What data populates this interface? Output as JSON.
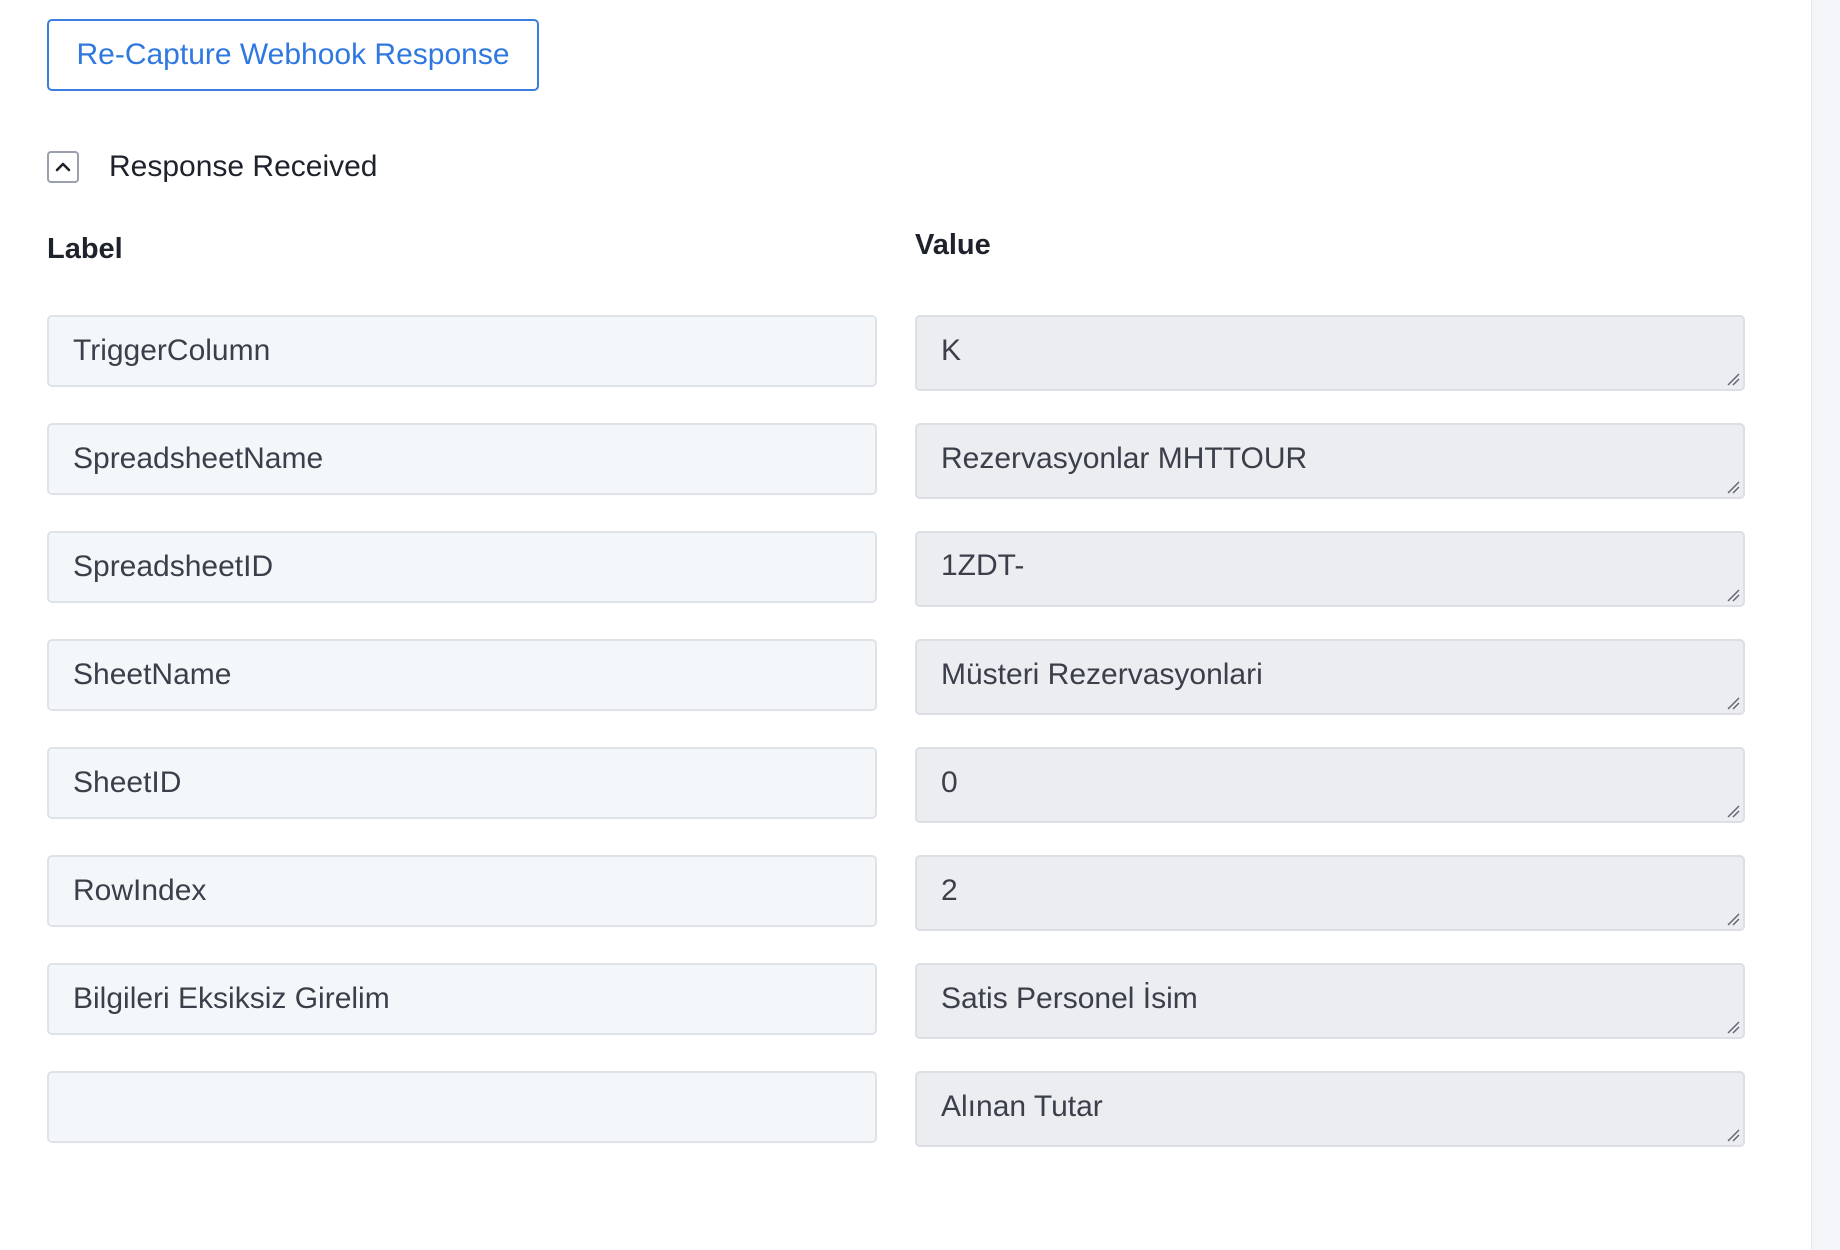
{
  "toolbar": {
    "recapture_label": "Re-Capture Webhook Response"
  },
  "response": {
    "title": "Response Received",
    "toggle_icon": "chevron-up-icon"
  },
  "table": {
    "label_header": "Label",
    "value_header": "Value",
    "rows": [
      {
        "label": "TriggerColumn",
        "value": "K"
      },
      {
        "label": "SpreadsheetName",
        "value": "Rezervasyonlar MHTTOUR"
      },
      {
        "label": "SpreadsheetID",
        "value": "1ZDT-"
      },
      {
        "label": "SheetName",
        "value": "Müsteri Rezervasyonlari"
      },
      {
        "label": "SheetID",
        "value": "0"
      },
      {
        "label": "RowIndex",
        "value": "2"
      },
      {
        "label": "Bilgileri Eksiksiz Girelim",
        "value": "Satis Personel İsim"
      },
      {
        "label": "",
        "value": "Alınan Tutar"
      }
    ]
  },
  "colors": {
    "accent": "#2f78e0",
    "label_bg": "#f4f7fa",
    "value_bg": "#ebedf0"
  }
}
